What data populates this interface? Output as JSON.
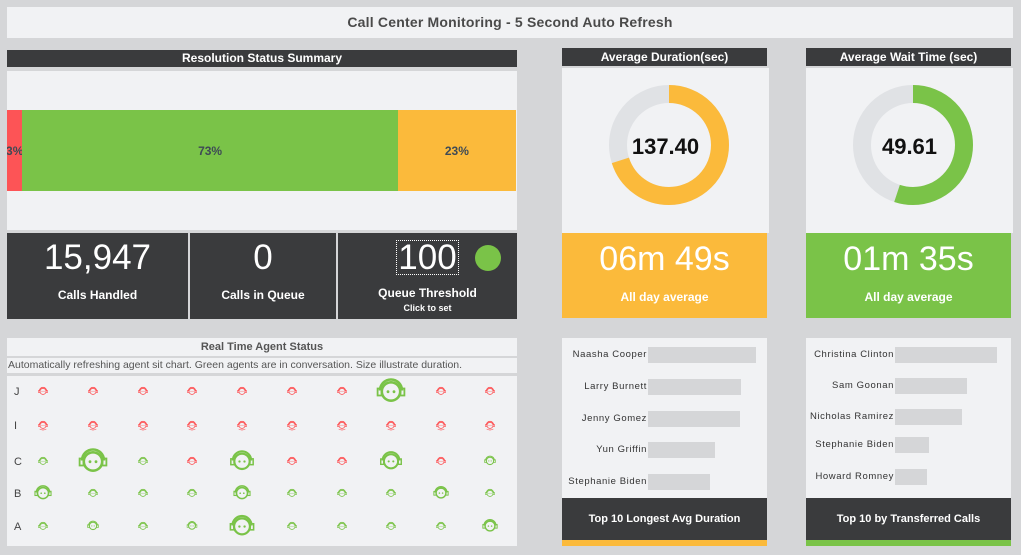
{
  "header": {
    "title": "Call Center Monitoring - 5 Second Auto Refresh"
  },
  "colors": {
    "red": "#fd5456",
    "green": "#7ac348",
    "orange": "#fbba3b",
    "dark": "#3a3b3d",
    "panel": "#f1f2f4",
    "track": "#e0e2e5"
  },
  "resolution": {
    "title": "Resolution Status Summary",
    "segments": [
      {
        "label": "3%",
        "value": 3,
        "color": "#fd5456"
      },
      {
        "label": "73%",
        "value": 73,
        "color": "#7ac348"
      },
      {
        "label": "23%",
        "value": 23,
        "color": "#fbba3b"
      }
    ]
  },
  "kpis": {
    "calls_handled": {
      "value": "15,947",
      "label": "Calls Handled"
    },
    "calls_in_queue": {
      "value": "0",
      "label": "Calls in Queue"
    },
    "queue_threshold": {
      "value": "100",
      "label": "Queue Threshold",
      "sublabel": "Click to set",
      "status_color": "#7ac348"
    }
  },
  "avg_duration": {
    "title": "Average Duration(sec)",
    "value": "137.40",
    "fraction": 0.7,
    "color": "#fbba3b",
    "all_day": "06m 49s",
    "all_day_label": "All day average"
  },
  "avg_wait": {
    "title": "Average Wait Time (sec)",
    "value": "49.61",
    "fraction": 0.55,
    "color": "#7ac348",
    "all_day": "01m 35s",
    "all_day_label": "All day average"
  },
  "agent_status": {
    "title": "Real Time Agent Status",
    "description": "Automatically refreshing agent sit chart. Green agents are in conversation. Size illustrate duration.",
    "rows": [
      {
        "label": "J",
        "agents": [
          [
            "red",
            1
          ],
          [
            "red",
            1
          ],
          [
            "red",
            1
          ],
          [
            "red",
            1
          ],
          [
            "red",
            1
          ],
          [
            "red",
            1
          ],
          [
            "red",
            1
          ],
          [
            "green",
            3
          ],
          [
            "red",
            1
          ],
          [
            "red",
            1
          ]
        ]
      },
      {
        "label": "I",
        "agents": [
          [
            "red-chin",
            1
          ],
          [
            "red-chin",
            1
          ],
          [
            "red-chin",
            1
          ],
          [
            "red-chin",
            1
          ],
          [
            "red-chin",
            1
          ],
          [
            "red-chin",
            1
          ],
          [
            "red-chin",
            1
          ],
          [
            "red-chin",
            1
          ],
          [
            "red-chin",
            1
          ],
          [
            "red-chin",
            1
          ]
        ]
      },
      {
        "label": "C",
        "agents": [
          [
            "green",
            1
          ],
          [
            "green",
            3
          ],
          [
            "green",
            1
          ],
          [
            "red",
            1
          ],
          [
            "green",
            2.5
          ],
          [
            "red",
            1
          ],
          [
            "red",
            1
          ],
          [
            "green",
            2.3
          ],
          [
            "red",
            1
          ],
          [
            "green",
            1.2
          ]
        ]
      },
      {
        "label": "B",
        "agents": [
          [
            "green",
            1.8
          ],
          [
            "green",
            1
          ],
          [
            "green",
            1
          ],
          [
            "green",
            1
          ],
          [
            "green",
            1.8
          ],
          [
            "green",
            1
          ],
          [
            "green",
            1
          ],
          [
            "green",
            1
          ],
          [
            "green",
            1.6
          ],
          [
            "green",
            1
          ]
        ]
      },
      {
        "label": "A",
        "agents": [
          [
            "green",
            1
          ],
          [
            "green",
            1.2
          ],
          [
            "green",
            1
          ],
          [
            "green",
            1.1
          ],
          [
            "green",
            2.6
          ],
          [
            "green",
            1
          ],
          [
            "green",
            1
          ],
          [
            "green",
            1
          ],
          [
            "green",
            1
          ],
          [
            "green",
            1.6
          ]
        ]
      }
    ]
  },
  "top_duration": {
    "title": "Top 10 Longest Avg Duration",
    "accent": "#fbba3b",
    "items": [
      {
        "name": "Naasha Cooper",
        "value": 108
      },
      {
        "name": "Larry Burnett",
        "value": 93
      },
      {
        "name": "Jenny Gomez",
        "value": 92
      },
      {
        "name": "Yun Griffin",
        "value": 67
      },
      {
        "name": "Stephanie Biden",
        "value": 62
      }
    ]
  },
  "top_transferred": {
    "title": "Top 10 by Transferred Calls",
    "accent": "#7ac348",
    "items": [
      {
        "name": "Christina Clinton",
        "value": 102
      },
      {
        "name": "Sam Goonan",
        "value": 72
      },
      {
        "name": "Nicholas Ramirez",
        "value": 67
      },
      {
        "name": "Stephanie Biden",
        "value": 34
      },
      {
        "name": "Howard Romney",
        "value": 32
      }
    ]
  }
}
